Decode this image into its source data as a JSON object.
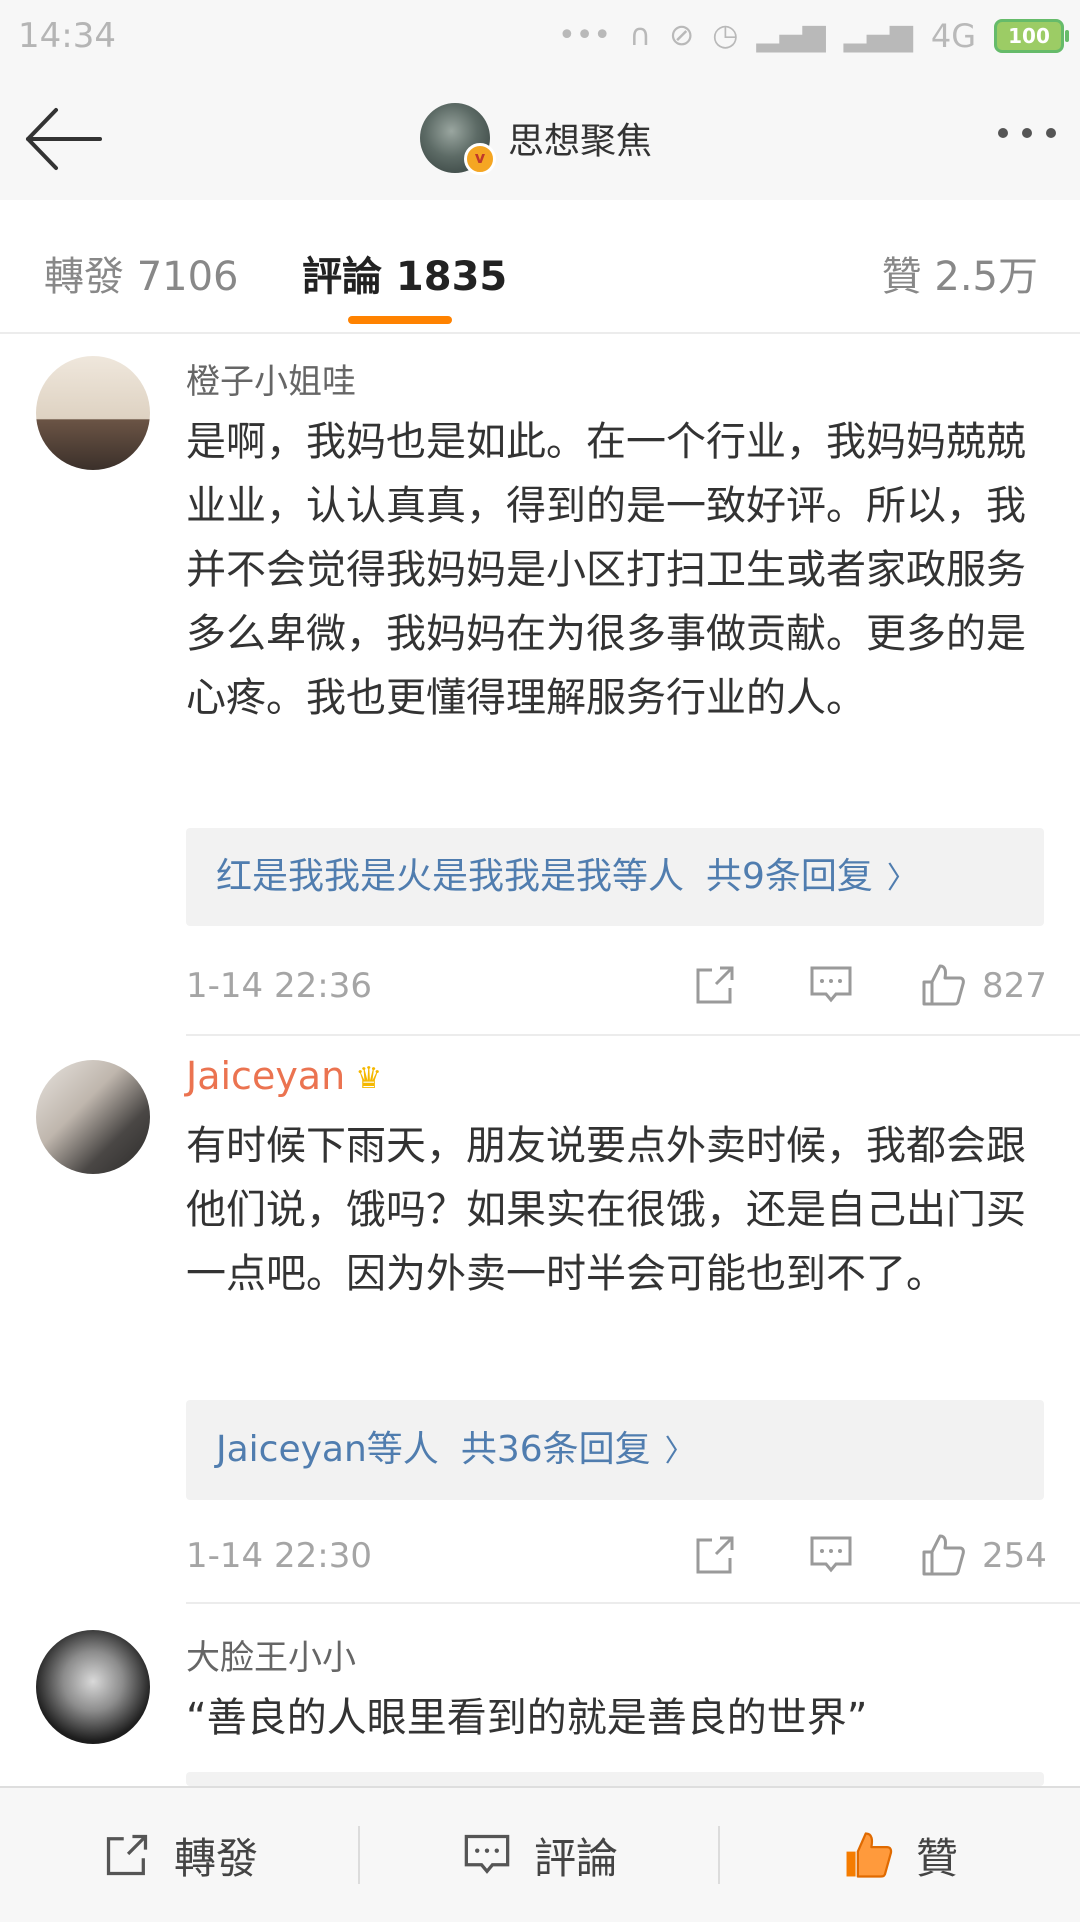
{
  "status_bar": {
    "time": "14:34",
    "network": "4G",
    "battery": "100"
  },
  "header": {
    "title": "思想聚焦",
    "verified_badge": "v"
  },
  "tabs": {
    "repost": "轉發 7106",
    "comment": "評論 1835",
    "like": "贊 2.5万"
  },
  "comments": [
    {
      "username": "橙子小姐哇",
      "text": "是啊，我妈也是如此。在一个行业，我妈妈兢兢业业，认认真真，得到的是一致好评。所以，我并不会觉得我妈妈是小区打扫卫生或者家政服务多么卑微，我妈妈在为很多事做贡献。更多的是心疼。我也更懂得理解服务行业的人。",
      "replies_users": "红是我我是火是我我是我等人",
      "replies_count": "共9条回复",
      "time": "1-14 22:36",
      "likes": "827"
    },
    {
      "username": "Jaiceyan",
      "text": "有时候下雨天，朋友说要点外卖时候，我都会跟他们说，饿吗？如果实在很饿，还是自己出门买一点吧。因为外卖一时半会可能也到不了。",
      "replies_users": "Jaiceyan等人",
      "replies_count": "共36条回复",
      "time": "1-14 22:30",
      "likes": "254"
    },
    {
      "username": "大脸王小小",
      "text": "“善良的人眼里看到的就是善良的世界”"
    }
  ],
  "bottom_bar": {
    "repost": "轉發",
    "comment": "評論",
    "like": "贊"
  },
  "colors": {
    "accent": "#ff8200",
    "link": "#507daf",
    "vip_name": "#eb7350",
    "like_active": "#f57c00"
  },
  "icons": [
    "back-arrow-icon",
    "more-icon",
    "share-icon",
    "reply-icon",
    "thumbs-up-icon",
    "crown-icon"
  ]
}
